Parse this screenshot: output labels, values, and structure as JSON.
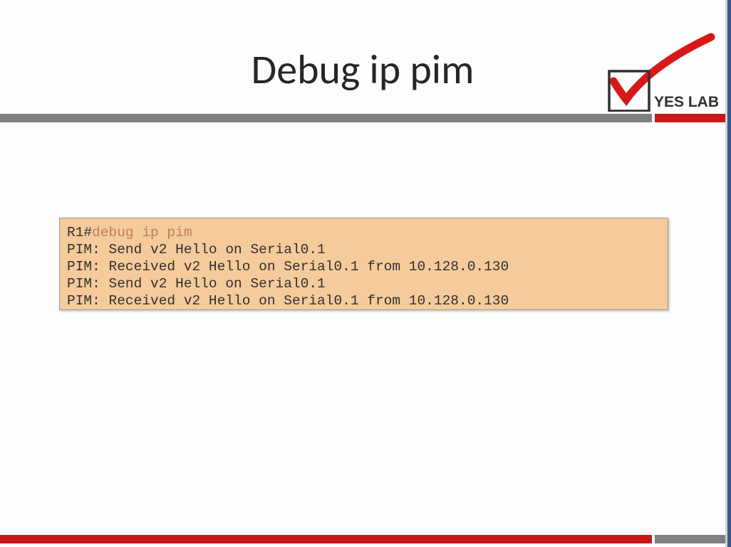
{
  "title": "Debug ip pim",
  "logo": {
    "text": "YES LAB"
  },
  "terminal": {
    "prompt": "R1#",
    "command": "debug ip pim",
    "lines": [
      "PIM: Send v2 Hello on Serial0.1",
      "PIM: Received v2 Hello on Serial0.1 from 10.128.0.130",
      "PIM: Send v2 Hello on Serial0.1",
      "PIM: Received v2 Hello on Serial0.1 from 10.128.0.130"
    ]
  }
}
